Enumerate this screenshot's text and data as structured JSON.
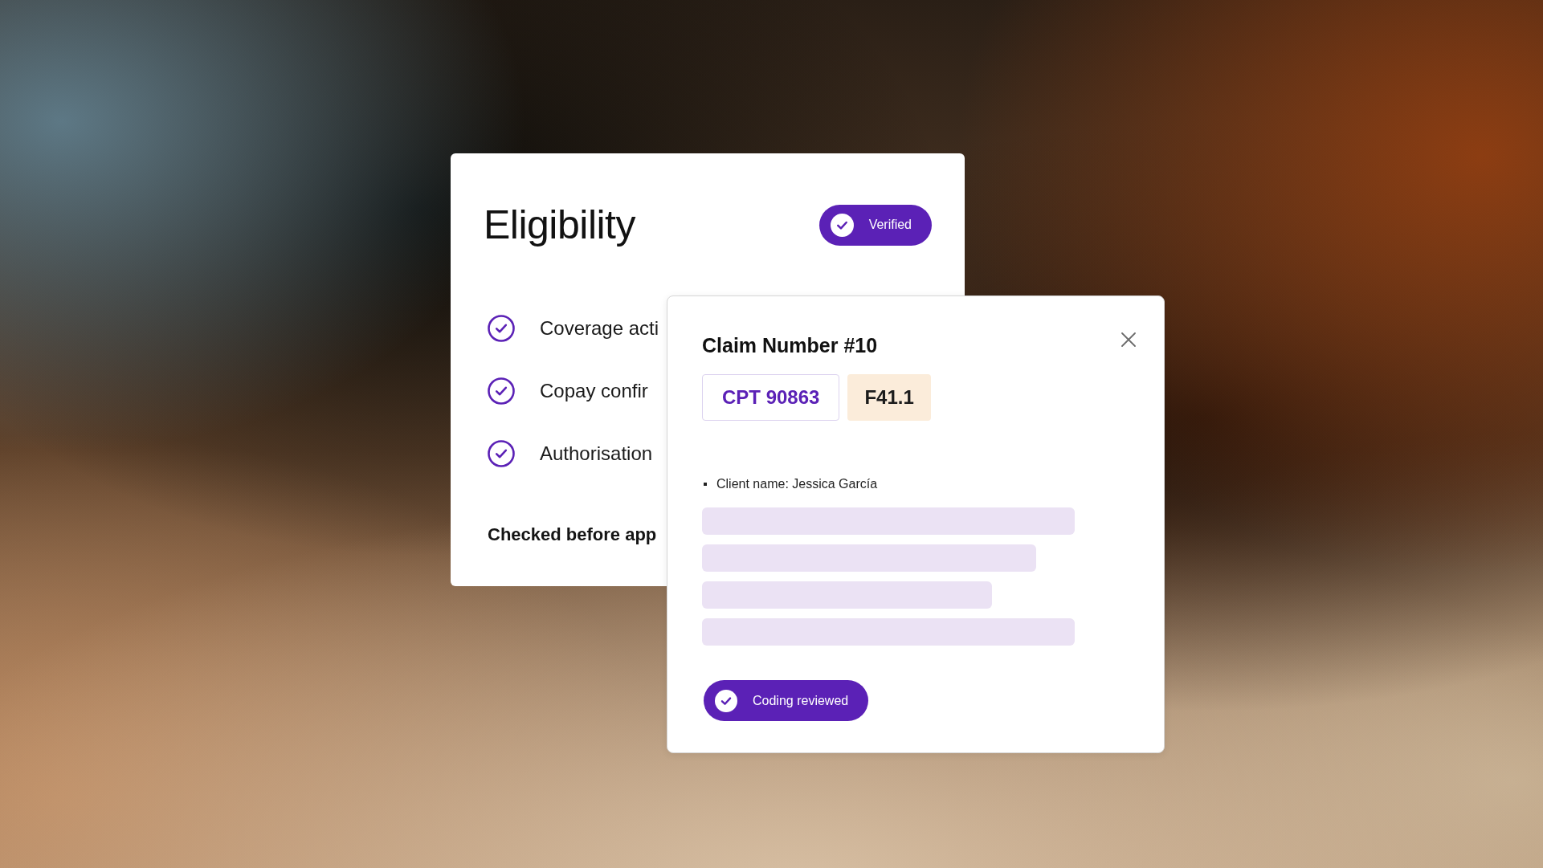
{
  "eligibility_card": {
    "title": "Eligibility",
    "status_badge": {
      "label": "Verified"
    },
    "checklist": [
      {
        "label": "Coverage acti",
        "checked": true
      },
      {
        "label": "Copay confir",
        "checked": true
      },
      {
        "label": "Authorisation",
        "checked": true
      }
    ],
    "footer": "Checked before app"
  },
  "claim_card": {
    "title": "Claim Number #10",
    "codes": [
      {
        "kind": "procedure",
        "label": "CPT 90863"
      },
      {
        "kind": "diagnosis",
        "label": "F41.1"
      }
    ],
    "details": [
      "Client name: Jessica García"
    ],
    "status_badge": {
      "label": "Coding reviewed"
    }
  }
}
